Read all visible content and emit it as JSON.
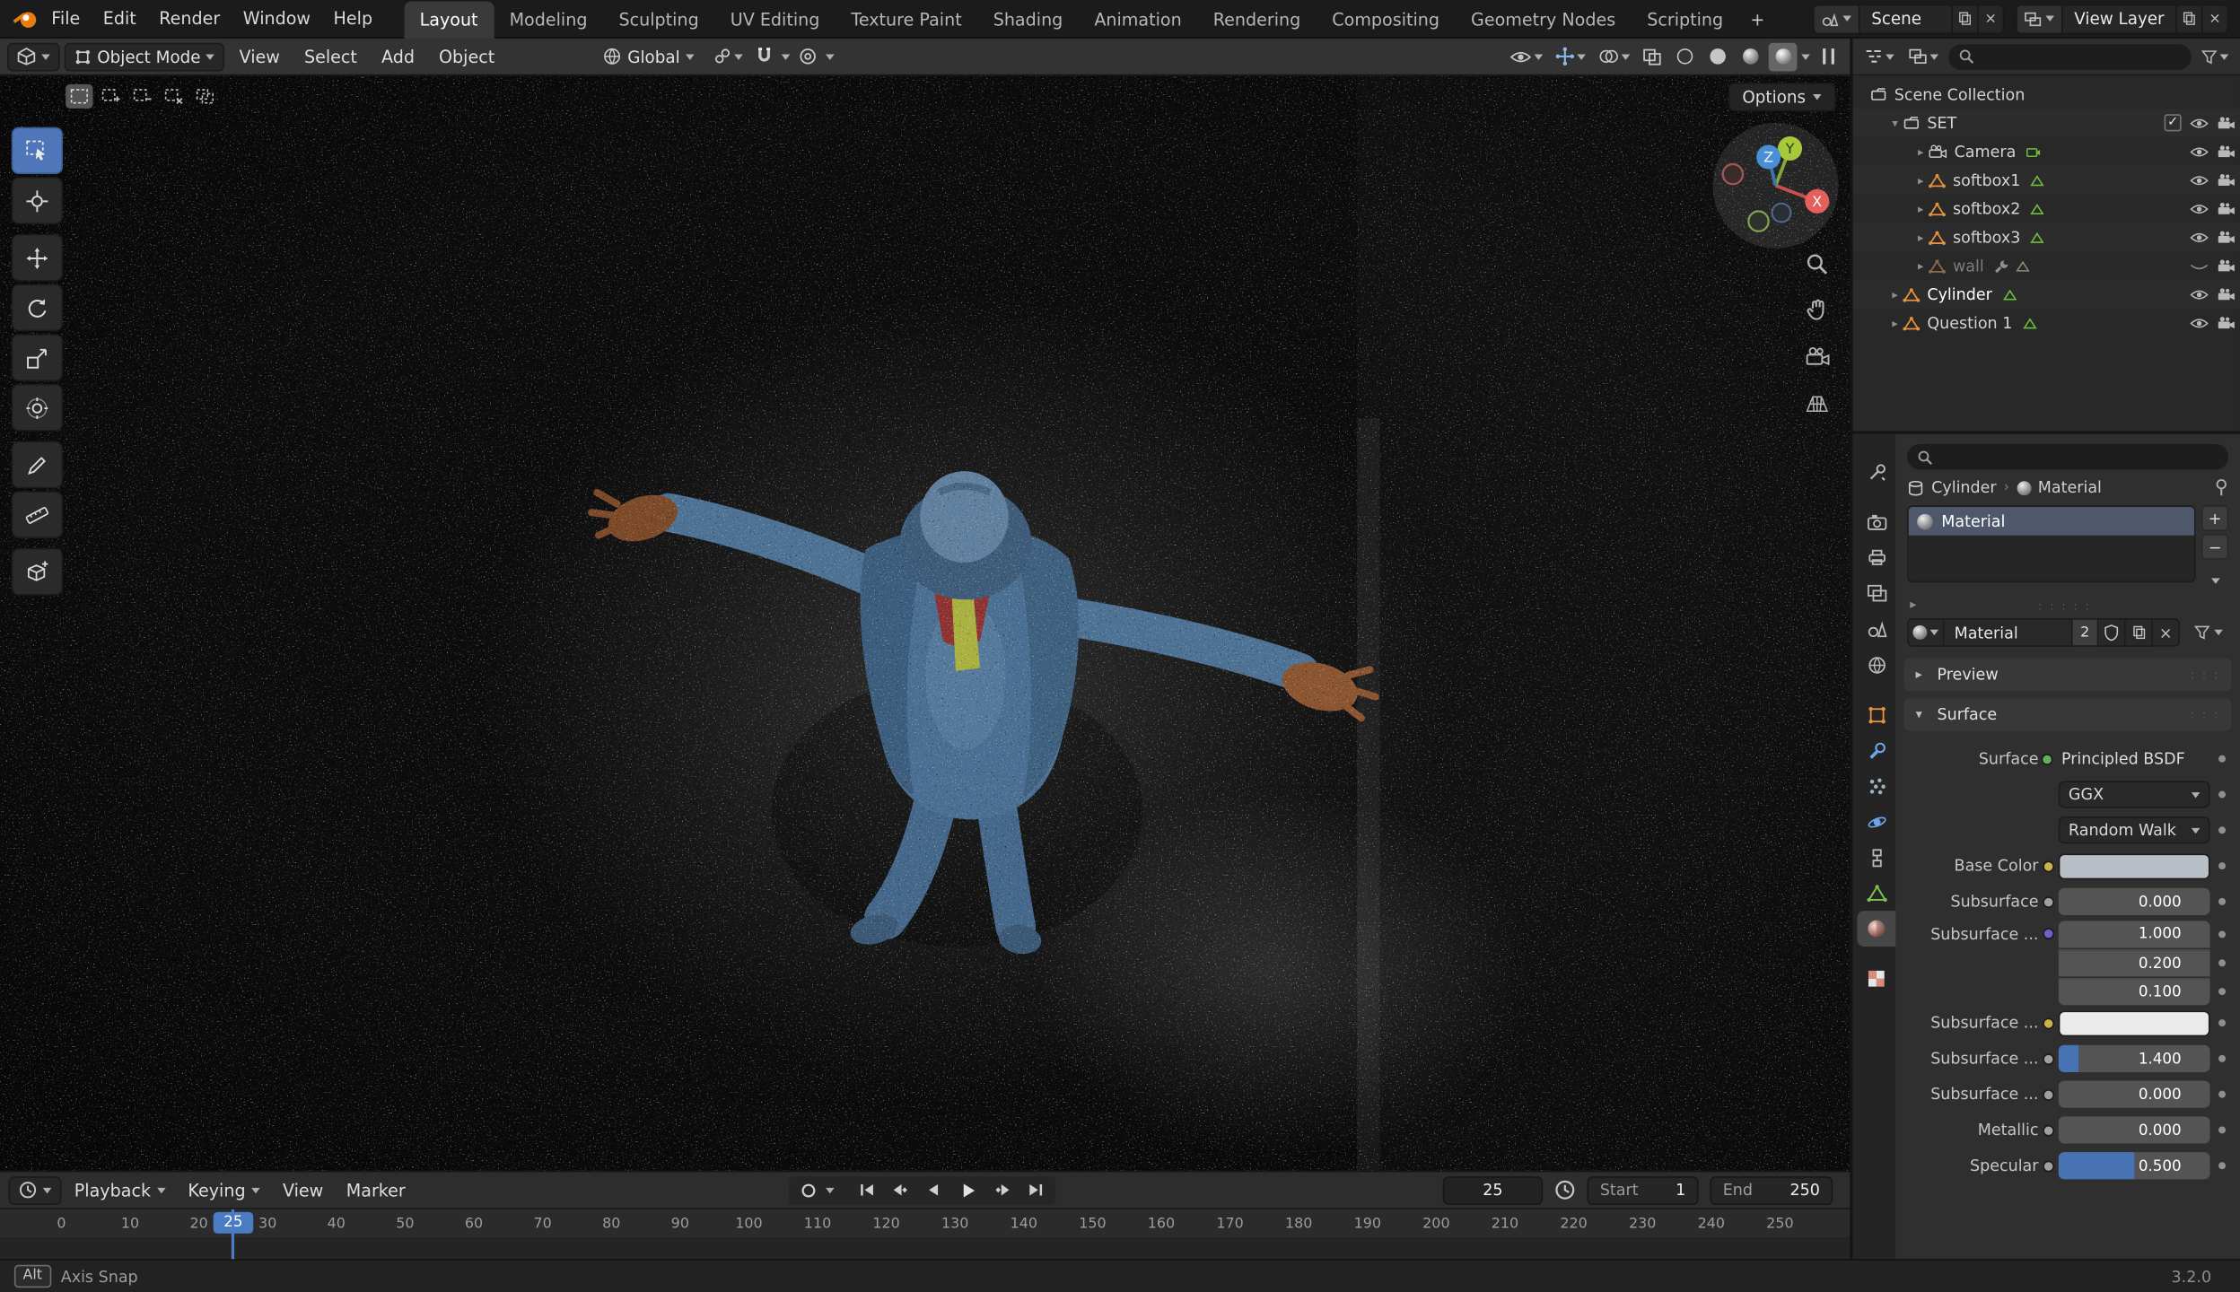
{
  "app": {
    "version_label": "3.2.0"
  },
  "colors": {
    "accent_blue": "#4772b3",
    "object_orange": "#e8913f",
    "data_green": "#6cbf3c",
    "logo_orange": "#e87d0d"
  },
  "topbar": {
    "menus": [
      "File",
      "Edit",
      "Render",
      "Window",
      "Help"
    ],
    "tabs": [
      "Layout",
      "Modeling",
      "Sculpting",
      "UV Editing",
      "Texture Paint",
      "Shading",
      "Animation",
      "Rendering",
      "Compositing",
      "Geometry Nodes",
      "Scripting"
    ],
    "add_tab_label": "+",
    "scene_name": "Scene",
    "view_layer_name": "View Layer"
  },
  "viewport": {
    "mode": "Object Mode",
    "menus": [
      "View",
      "Select",
      "Add",
      "Object"
    ],
    "orientation": "Global",
    "options_label": "Options",
    "gizmo": {
      "x": "X",
      "y": "Y",
      "z": "Z"
    }
  },
  "outliner": {
    "rows": [
      {
        "label": "Scene Collection"
      },
      {
        "label": "SET"
      },
      {
        "label": "Camera"
      },
      {
        "label": "softbox1"
      },
      {
        "label": "softbox2"
      },
      {
        "label": "softbox3"
      },
      {
        "label": "wall"
      },
      {
        "label": "Cylinder"
      },
      {
        "label": "Question 1"
      }
    ]
  },
  "properties": {
    "breadcrumb": {
      "object": "Cylinder",
      "data": "Material"
    },
    "slot_name": "Material",
    "datablock": {
      "name": "Material",
      "users": "2"
    },
    "panel_preview": "Preview",
    "panel_surface": "Surface",
    "surface": {
      "label": "Surface",
      "shader": "Principled BSDF",
      "distribution": "GGX",
      "method": "Random Walk",
      "rows": {
        "base_color": {
          "label": "Base Color",
          "swatch": "#b9bfc7"
        },
        "subsurface": {
          "label": "Subsurface",
          "value": "0.000",
          "fill": "0%"
        },
        "radius1": {
          "label": "Subsurface ...",
          "value": "1.000",
          "fill": "0%"
        },
        "radius2": {
          "value": "0.200",
          "fill": "0%"
        },
        "radius3": {
          "value": "0.100",
          "fill": "0%"
        },
        "ss_color": {
          "label": "Subsurface ...",
          "swatch": "#eaeaea"
        },
        "ss_ior": {
          "label": "Subsurface ...",
          "value": "1.400",
          "fill": "13%"
        },
        "ss_aniso": {
          "label": "Subsurface ...",
          "value": "0.000",
          "fill": "0%"
        },
        "metallic": {
          "label": "Metallic",
          "value": "0.000",
          "fill": "0%"
        },
        "specular": {
          "label": "Specular",
          "value": "0.500",
          "fill": "50%"
        }
      }
    }
  },
  "timeline": {
    "menus": [
      "Playback",
      "Keying",
      "View",
      "Marker"
    ],
    "current_frame": "25",
    "start_label": "Start",
    "start_value": "1",
    "end_label": "End",
    "end_value": "250",
    "playhead": {
      "frame": 25,
      "label": "25"
    },
    "ruler_ticks": [
      "0",
      "10",
      "20",
      "30",
      "40",
      "50",
      "60",
      "70",
      "80",
      "90",
      "100",
      "110",
      "120",
      "130",
      "140",
      "150",
      "160",
      "170",
      "180",
      "190",
      "200",
      "210",
      "220",
      "230",
      "240",
      "250"
    ]
  },
  "statusbar": {
    "key_hint": "Alt",
    "action_hint": "Axis Snap",
    "version": "3.2.0"
  }
}
